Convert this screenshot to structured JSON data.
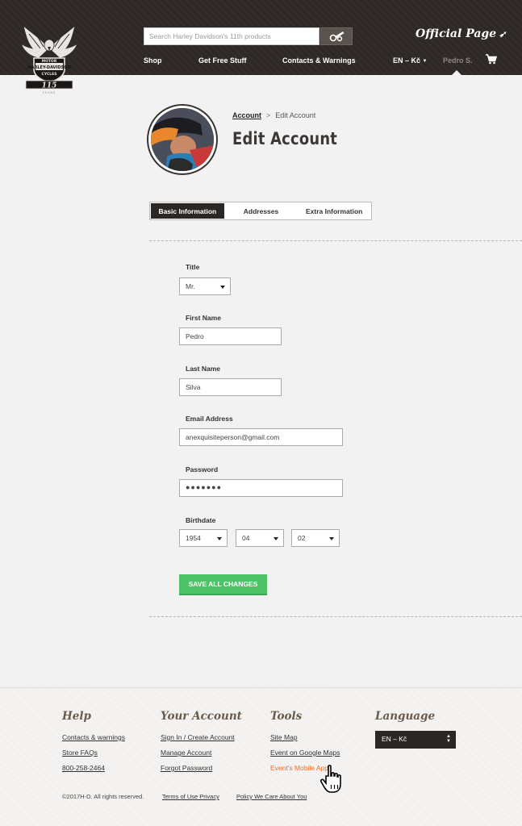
{
  "header": {
    "logo_alt": "Harley-Davidson Motor Cycles 115 Years",
    "search_placeholder": "Search Harley Davidson's 11th products",
    "official_page": "Official Page",
    "nav": {
      "shop": "Shop",
      "free_stuff": "Get Free Stuff",
      "contacts": "Contacts & Warnings",
      "locale": "EN – Kč",
      "user": "Pedro S."
    }
  },
  "profile": {
    "breadcrumb_root": "Account",
    "breadcrumb_sep": ">",
    "breadcrumb_current": "Edit Account",
    "title": "Edit Account"
  },
  "tabs": [
    {
      "label": "Basic Information",
      "active": true
    },
    {
      "label": "Addresses",
      "active": false
    },
    {
      "label": "Extra Information",
      "active": false
    }
  ],
  "form": {
    "title_label": "Title",
    "title_value": "Mr.",
    "first_name_label": "First Name",
    "first_name_value": "Pedro",
    "last_name_label": "Last Name",
    "last_name_value": "Silva",
    "email_label": "Email Address",
    "email_value": "anexquisiteperson@gmail.com",
    "password_label": "Password",
    "password_value": "●●●●●●●",
    "birthdate_label": "Birthdate",
    "birth_year": "1954",
    "birth_month": "04",
    "birth_day": "02",
    "save_label": "SAVE ALL CHANGES"
  },
  "footer": {
    "help": {
      "heading": "Help",
      "links": [
        "Contacts & warnings",
        "Store FAQs",
        "800-258-2464"
      ]
    },
    "account": {
      "heading": "Your Account",
      "links": [
        "Sign In / Create Account",
        "Manage Account",
        "Forgot Password"
      ]
    },
    "tools": {
      "heading": "Tools",
      "links": [
        "Site Map",
        "Event on Google Maps",
        "Event's Mobile App"
      ]
    },
    "language": {
      "heading": "Language",
      "value": "EN – Kč"
    },
    "copyright": "©2017H-D. All rights reserved.",
    "terms": "Terms of Use Privacy",
    "policy": "Policy We Care About You"
  },
  "colors": {
    "header_bg": "#2e2926",
    "accent_green": "#4ec266",
    "link_orange": "#f26a21"
  }
}
